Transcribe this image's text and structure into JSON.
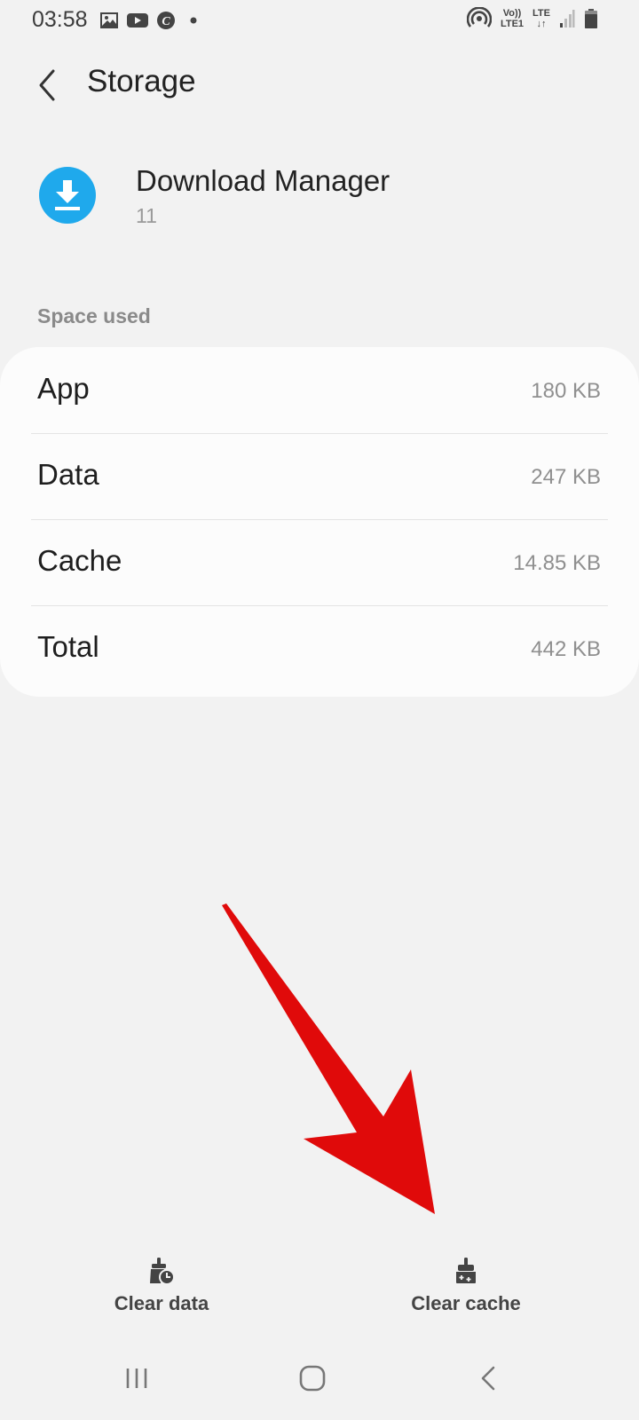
{
  "status_bar": {
    "time": "03:58",
    "left_icons": [
      "gallery-icon",
      "youtube-icon",
      "c-app-icon",
      "dot-icon"
    ],
    "volte_label_top": "Vo))",
    "volte_label_bottom": "LTE1",
    "lte_label": "LTE",
    "lte_arrows": "↓↑",
    "right_icons": [
      "hotspot-icon",
      "volte-icon",
      "lte-icon",
      "signal-icon",
      "battery-icon"
    ]
  },
  "header": {
    "back_icon": "back-chevron-icon",
    "title": "Storage"
  },
  "app": {
    "name": "Download Manager",
    "version": "11",
    "icon_color": "#1fa9ec"
  },
  "space_used": {
    "section_label": "Space used",
    "rows": [
      {
        "label": "App",
        "value": "180 KB"
      },
      {
        "label": "Data",
        "value": "247 KB"
      },
      {
        "label": "Cache",
        "value": "14.85 KB"
      },
      {
        "label": "Total",
        "value": "442 KB"
      }
    ]
  },
  "annotation": {
    "arrow_color": "#e00a0a"
  },
  "actions": {
    "clear_data": "Clear data",
    "clear_cache": "Clear cache"
  },
  "nav_bar": {
    "recents": "recents-icon",
    "home": "home-icon",
    "back": "back-icon"
  }
}
